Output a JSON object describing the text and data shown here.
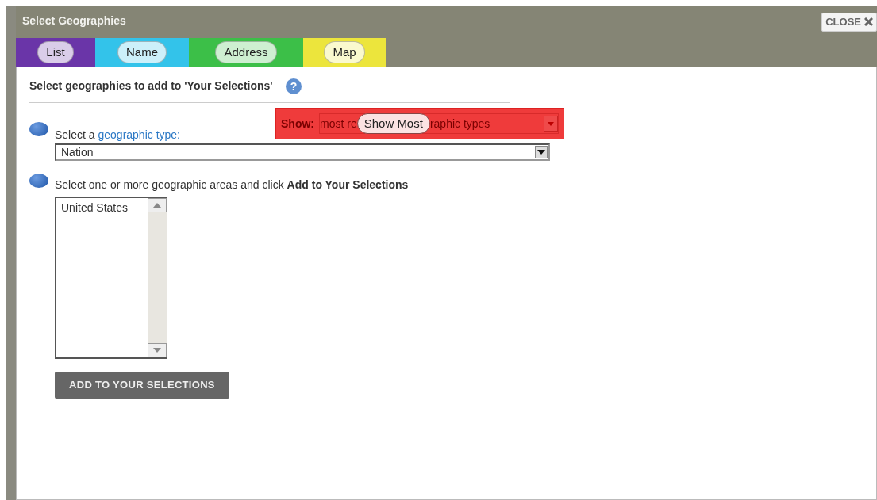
{
  "dialog": {
    "title": "Select Geographies",
    "close_label": "CLOSE"
  },
  "tabs": [
    {
      "label": "List",
      "color": "#6a35a8"
    },
    {
      "label": "Name",
      "color": "#33c3ea"
    },
    {
      "label": "Address",
      "color": "#3cbf48"
    },
    {
      "label": "Map",
      "color": "#ece53c"
    }
  ],
  "heading": "Select geographies to add to 'Your Selections'",
  "help": "?",
  "show_filter": {
    "label": "Show:",
    "value_before": "most re",
    "overlay": "Show Most",
    "value_after": "raphic types"
  },
  "step_1": {
    "text": "Select a ",
    "link": "geographic type:",
    "value": "Nation"
  },
  "step_2": {
    "text": "Select one or more geographic areas and click **Add to Your Selections**",
    "options": [
      {
        "label": "United States",
        "selected": false
      }
    ]
  },
  "add_button": "ADD TO YOUR SELECTIONS"
}
